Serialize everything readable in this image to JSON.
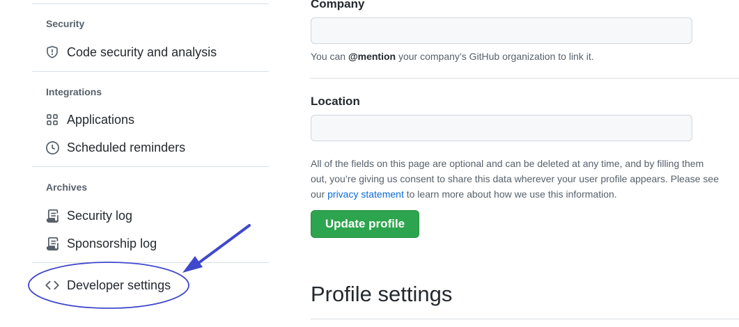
{
  "sidebar": {
    "sections": [
      {
        "heading": "Security",
        "items": [
          {
            "label": "Code security and analysis",
            "icon": "shield-icon"
          }
        ]
      },
      {
        "heading": "Integrations",
        "items": [
          {
            "label": "Applications",
            "icon": "apps-grid-icon"
          },
          {
            "label": "Scheduled reminders",
            "icon": "clock-icon"
          }
        ]
      },
      {
        "heading": "Archives",
        "items": [
          {
            "label": "Security log",
            "icon": "log-icon"
          },
          {
            "label": "Sponsorship log",
            "icon": "log-icon"
          }
        ]
      }
    ],
    "developer_settings": {
      "label": "Developer settings",
      "icon": "code-icon"
    }
  },
  "main": {
    "company": {
      "label": "Company",
      "value": "",
      "note_prefix": "You can ",
      "note_bold": "@mention",
      "note_suffix": " your company’s GitHub organization to link it."
    },
    "location": {
      "label": "Location",
      "value": ""
    },
    "consent": {
      "line1": "All of the fields on this page are optional and can be deleted at any time, and by filling them",
      "line2": "out, you’re giving us consent to share this data wherever your user profile appears. Please see",
      "line3_prefix": "our ",
      "link_text": "privacy statement",
      "line3_suffix": " to learn more about how we use this information."
    },
    "update_button": "Update profile",
    "profile_heading": "Profile settings"
  },
  "colors": {
    "primary_button": "#2da44e",
    "link": "#0969da",
    "annotation": "#3f48cc"
  }
}
